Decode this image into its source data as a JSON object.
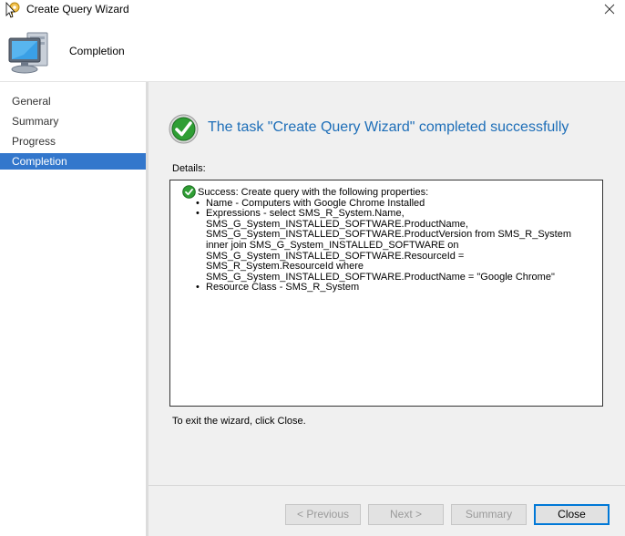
{
  "window": {
    "title": "Create Query Wizard",
    "app_icon": "wizard-key-icon",
    "close_icon": "close-icon"
  },
  "header": {
    "title": "Completion",
    "icon": "computer-monitor-icon"
  },
  "sidebar": {
    "items": [
      {
        "label": "General",
        "active": false
      },
      {
        "label": "Summary",
        "active": false
      },
      {
        "label": "Progress",
        "active": false
      },
      {
        "label": "Completion",
        "active": true
      }
    ],
    "active_color": "#3377cc"
  },
  "main": {
    "headline": "The task \"Create Query Wizard\" completed successfully",
    "headline_color": "#1d6eb8",
    "details_label": "Details:",
    "details": {
      "success_line": "Success: Create query with the following properties:",
      "bullets": [
        "Name - Computers with Google Chrome Installed",
        "Expressions - select SMS_R_System.Name,\nSMS_G_System_INSTALLED_SOFTWARE.ProductName,\nSMS_G_System_INSTALLED_SOFTWARE.ProductVersion from  SMS_R_System\ninner join SMS_G_System_INSTALLED_SOFTWARE on\nSMS_G_System_INSTALLED_SOFTWARE.ResourceId =\nSMS_R_System.ResourceId where\nSMS_G_System_INSTALLED_SOFTWARE.ProductName = \"Google Chrome\"",
        "Resource Class - SMS_R_System"
      ]
    },
    "exit_text": "To exit the wizard, click Close."
  },
  "buttons": {
    "previous": {
      "label": "< Previous",
      "enabled": false
    },
    "next": {
      "label": "Next >",
      "enabled": false
    },
    "summary": {
      "label": "Summary",
      "enabled": false
    },
    "close": {
      "label": "Close",
      "enabled": true
    }
  }
}
